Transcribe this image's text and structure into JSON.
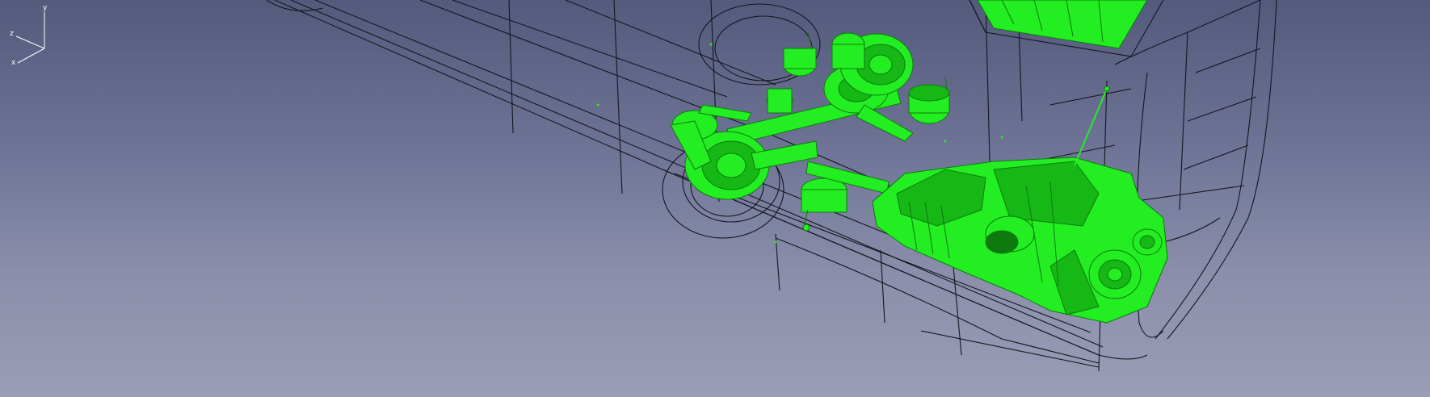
{
  "viewport": {
    "background_top": "#545a7c",
    "background_bottom": "#9a9db5",
    "wire_color": "#1a1a24",
    "part_color": "#22ee22",
    "part_dark": "#0e7a0e"
  },
  "triad": {
    "x_label": "x",
    "y_label": "y",
    "z_label": "z"
  }
}
